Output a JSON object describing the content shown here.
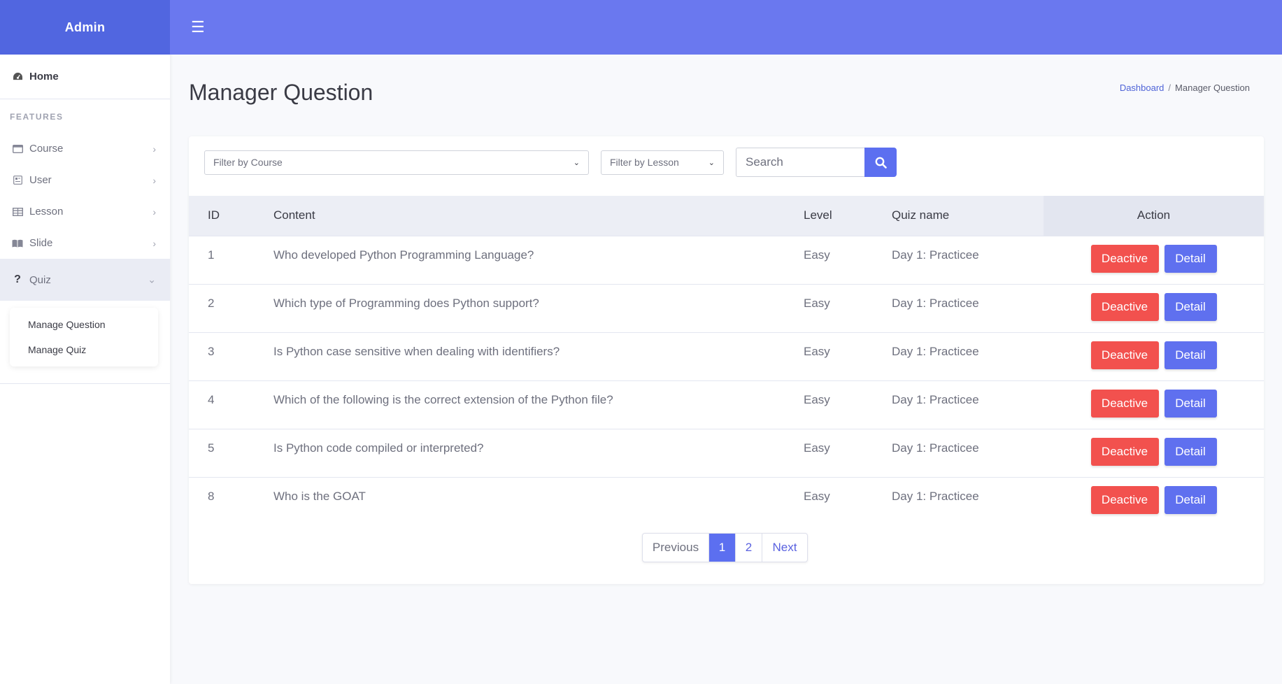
{
  "brand": "Admin",
  "sidebar": {
    "home": "Home",
    "section": "FEATURES",
    "items": [
      {
        "label": "Course",
        "icon": "window-icon"
      },
      {
        "label": "User",
        "icon": "id-card-icon"
      },
      {
        "label": "Lesson",
        "icon": "table-icon"
      },
      {
        "label": "Slide",
        "icon": "book-icon"
      },
      {
        "label": "Quiz",
        "icon": "question-icon"
      }
    ],
    "submenu": [
      "Manage Question",
      "Manage Quiz"
    ]
  },
  "page": {
    "title": "Manager Question",
    "breadcrumb": {
      "link": "Dashboard",
      "sep": "/",
      "current": "Manager Question"
    }
  },
  "filters": {
    "course": "Filter by Course",
    "lesson": "Filter by Lesson",
    "search_placeholder": "Search"
  },
  "table": {
    "headers": {
      "id": "ID",
      "content": "Content",
      "level": "Level",
      "quiz": "Quiz name",
      "action": "Action"
    },
    "rows": [
      {
        "id": "1",
        "content": "Who developed Python Programming Language?",
        "level": "Easy",
        "quiz": "Day 1: Practicee"
      },
      {
        "id": "2",
        "content": "Which type of Programming does Python support?",
        "level": "Easy",
        "quiz": "Day 1: Practicee"
      },
      {
        "id": "3",
        "content": "Is Python case sensitive when dealing with identifiers?",
        "level": "Easy",
        "quiz": "Day 1: Practicee"
      },
      {
        "id": "4",
        "content": "Which of the following is the correct extension of the Python file?",
        "level": "Easy",
        "quiz": "Day 1: Practicee"
      },
      {
        "id": "5",
        "content": "Is Python code compiled or interpreted?",
        "level": "Easy",
        "quiz": "Day 1: Practicee"
      },
      {
        "id": "8",
        "content": "Who is the GOAT",
        "level": "Easy",
        "quiz": "Day 1: Practicee"
      }
    ],
    "deactive_label": "Deactive",
    "detail_label": "Detail"
  },
  "pagination": {
    "previous": "Previous",
    "pages": [
      "1",
      "2"
    ],
    "current": "1",
    "next": "Next"
  },
  "colors": {
    "brand": "#5166e0",
    "topbar": "#6a78ef",
    "primary": "#5c6ff0",
    "danger": "#f2514e"
  }
}
